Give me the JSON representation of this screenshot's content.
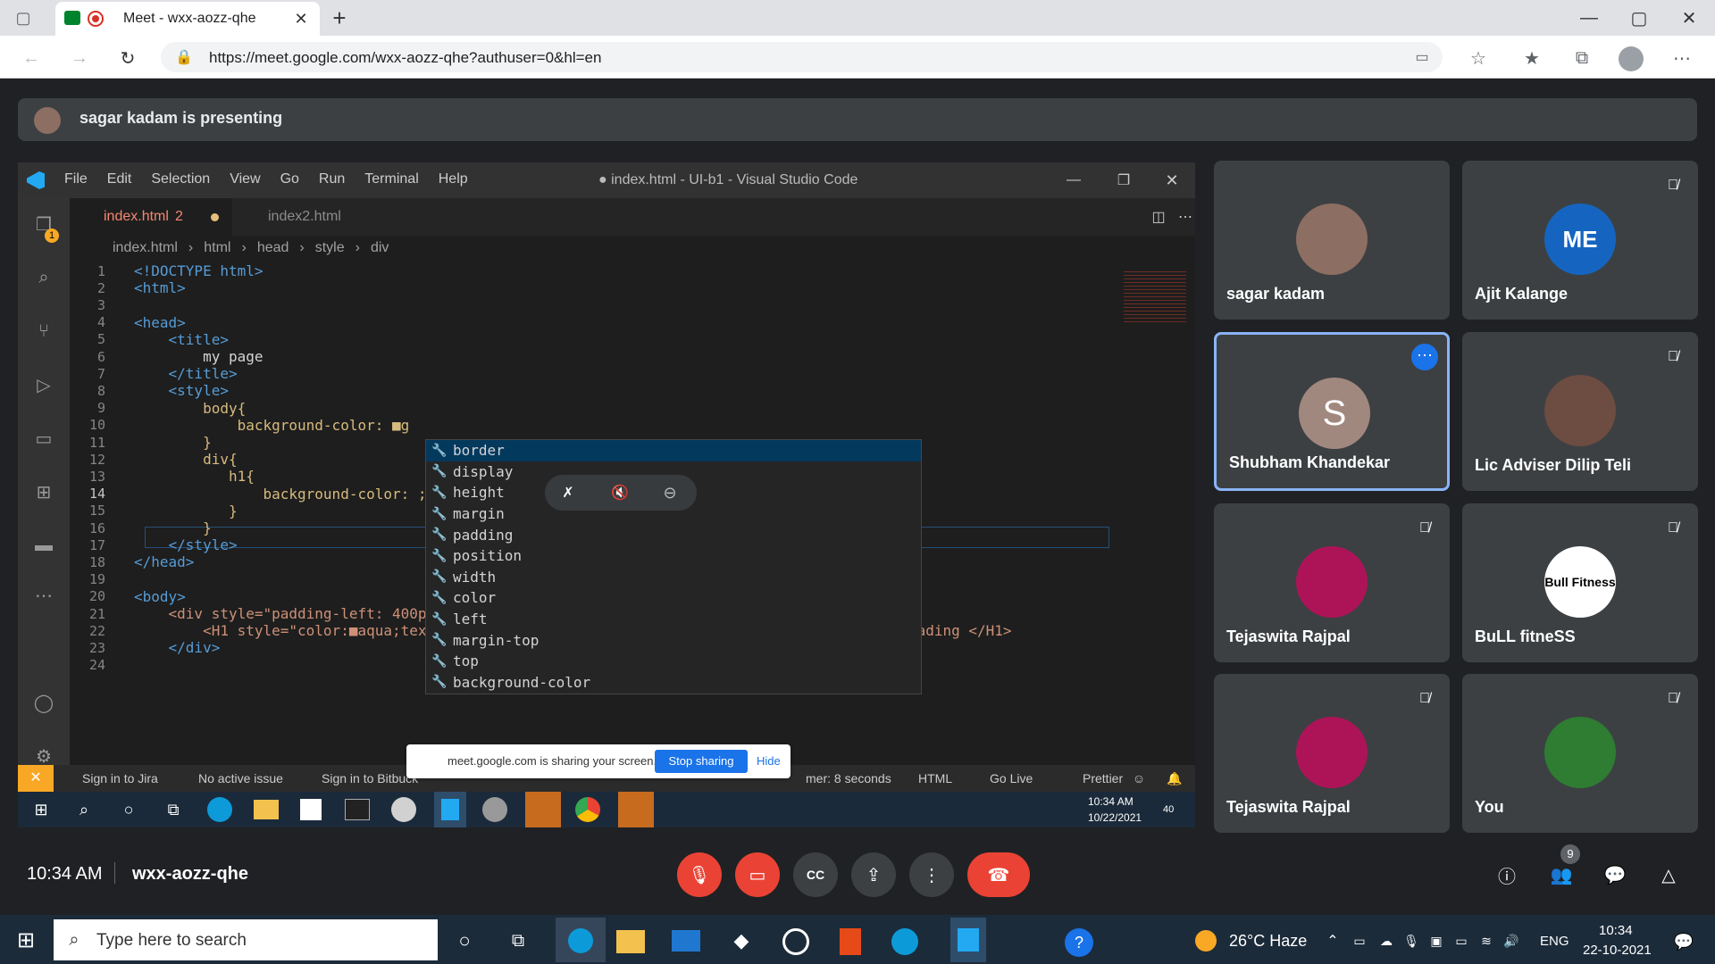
{
  "browser": {
    "tab_title": "Meet - wxx-aozz-qhe",
    "url": "https://meet.google.com/wxx-aozz-qhe?authuser=0&hl=en"
  },
  "meet": {
    "presenting_text": "sagar kadam is presenting",
    "time": "10:34 AM",
    "meeting_code": "wxx-aozz-qhe",
    "people_badge": "9",
    "participants": [
      {
        "name": "sagar kadam",
        "avatar": "photo",
        "muted": false
      },
      {
        "name": "Ajit Kalange",
        "avatar": "logo",
        "logo_text": "ME",
        "muted": true
      },
      {
        "name": "Shubham Khandekar",
        "avatar": "letter",
        "letter": "S",
        "muted": false,
        "speaking": true
      },
      {
        "name": "Lic Adviser Dilip Teli",
        "avatar": "photo",
        "muted": true
      },
      {
        "name": "Tejaswita Rajpal",
        "avatar": "photo",
        "muted": true
      },
      {
        "name": "BuLL fitneSS",
        "avatar": "logo",
        "logo_text": "Bull Fitness",
        "muted": true
      },
      {
        "name": "Tejaswita Rajpal",
        "avatar": "photo",
        "muted": true
      },
      {
        "name": "You",
        "avatar": "photo",
        "muted": true
      }
    ]
  },
  "vscode": {
    "menu": [
      "File",
      "Edit",
      "Selection",
      "View",
      "Go",
      "Run",
      "Terminal",
      "Help"
    ],
    "window_title": "● index.html - UI-b1 - Visual Studio Code",
    "tabs": [
      {
        "label": "index.html",
        "badge": "2",
        "active": true
      },
      {
        "label": "index2.html",
        "active": false
      }
    ],
    "breadcrumb": [
      "index.html",
      "html",
      "head",
      "style",
      "div"
    ],
    "lines": [
      {
        "n": "1",
        "code": "<!DOCTYPE html>"
      },
      {
        "n": "2",
        "code": "<html>"
      },
      {
        "n": "3",
        "code": ""
      },
      {
        "n": "4",
        "code": "<head>"
      },
      {
        "n": "5",
        "code": "    <title>"
      },
      {
        "n": "6",
        "code": "        my page"
      },
      {
        "n": "7",
        "code": "    </title>"
      },
      {
        "n": "8",
        "code": "    <style>"
      },
      {
        "n": "9",
        "code": "        body{"
      },
      {
        "n": "10",
        "code": "            background-color: ■g"
      },
      {
        "n": "11",
        "code": "        }"
      },
      {
        "n": "12",
        "code": "        div{"
      },
      {
        "n": "13",
        "code": "           h1{"
      },
      {
        "n": "14",
        "code": "               background-color: ;"
      },
      {
        "n": "15",
        "code": "           }"
      },
      {
        "n": "16",
        "code": "        }"
      },
      {
        "n": "17",
        "code": "    </style>"
      },
      {
        "n": "18",
        "code": "</head>"
      },
      {
        "n": "19",
        "code": ""
      },
      {
        "n": "20",
        "code": "<body>"
      },
      {
        "n": "21",
        "code": "    <div style=\"padding-left: 400px;\">"
      },
      {
        "n": "22",
        "code": "        <H1 style=\"color:■aqua;text-align: center;border:2px solid ■#ff6347;\"> This is a Heading </H1>"
      },
      {
        "n": "23",
        "code": "    </div>"
      },
      {
        "n": "24",
        "code": ""
      }
    ],
    "suggestions": [
      "border",
      "display",
      "height",
      "margin",
      "padding",
      "position",
      "width",
      "color",
      "left",
      "margin-top",
      "top",
      "background-color"
    ],
    "status_items": [
      "Sign in to Jira",
      "No active issue",
      "Sign in to Bitbuck",
      "mer: 8 seconds",
      "HTML",
      "Go Live",
      "Prettier"
    ],
    "share_banner_text": "meet.google.com is sharing your screen.",
    "stop_sharing": "Stop sharing",
    "hide": "Hide",
    "inner_clock_time": "10:34 AM",
    "inner_clock_date": "10/22/2021",
    "notif_count": "40"
  },
  "taskbar": {
    "search_placeholder": "Type here to search",
    "weather": "26°C Haze",
    "lang": "ENG",
    "time": "10:34",
    "date": "22-10-2021"
  }
}
